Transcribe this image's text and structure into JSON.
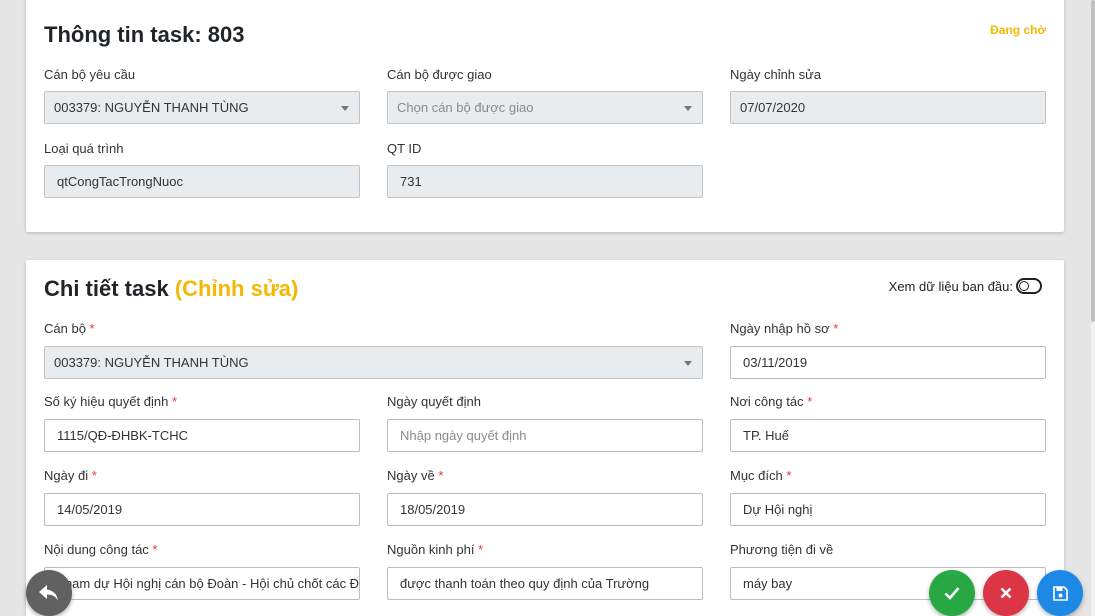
{
  "info_card": {
    "title": "Thông tin task: 803",
    "status": "Đang chờ",
    "requester_label": "Cán bộ yêu cầu",
    "requester_value": "003379: NGUYỄN THANH TÙNG",
    "assignee_label": "Cán bộ được giao",
    "assignee_placeholder": "Chọn cán bộ được giao",
    "modified_label": "Ngày chỉnh sửa",
    "modified_value": "07/07/2020",
    "process_label": "Loại quá trình",
    "process_value": "qtCongTacTrongNuoc",
    "qtid_label": "QT ID",
    "qtid_value": "731"
  },
  "detail_card": {
    "title": "Chi tiết task",
    "title_suffix": "(Chỉnh sửa)",
    "toggle_label": "Xem dữ liệu ban đầu:",
    "required_mark": "*",
    "staff_label": "Cán bộ",
    "staff_value": "003379: NGUYỄN THANH TÙNG",
    "entry_date_label": "Ngày nhập hồ sơ",
    "entry_date_value": "03/11/2019",
    "decision_no_label": "Số ký hiệu quyết định",
    "decision_no_value": "1115/QĐ-ĐHBK-TCHC",
    "decision_date_label": "Ngày quyết định",
    "decision_date_placeholder": "Nhập ngày quyết định",
    "workplace_label": "Nơi công tác",
    "workplace_value": "TP. Huế",
    "depart_label": "Ngày đi",
    "depart_value": "14/05/2019",
    "return_label": "Ngày về",
    "return_value": "18/05/2019",
    "purpose_label": "Mục đích",
    "purpose_value": "Dự Hội nghị",
    "content_label": "Nội dung công tác",
    "content_value": "Tham dự Hội nghị cán bộ Đoàn - Hội chủ chốt các Đại học",
    "funding_label": "Nguồn kinh phí",
    "funding_value": "được thanh toán theo quy định của Trường",
    "transport_label": "Phương tiện đi về",
    "transport_value": "máy bay"
  },
  "colors": {
    "accent": "#f5b800",
    "approve": "#28a745",
    "reject": "#dc3545",
    "save": "#1e88e5",
    "back": "#616161"
  },
  "icons": {
    "back": "reply-icon",
    "approve": "check-icon",
    "reject": "close-icon",
    "save": "save-icon"
  }
}
